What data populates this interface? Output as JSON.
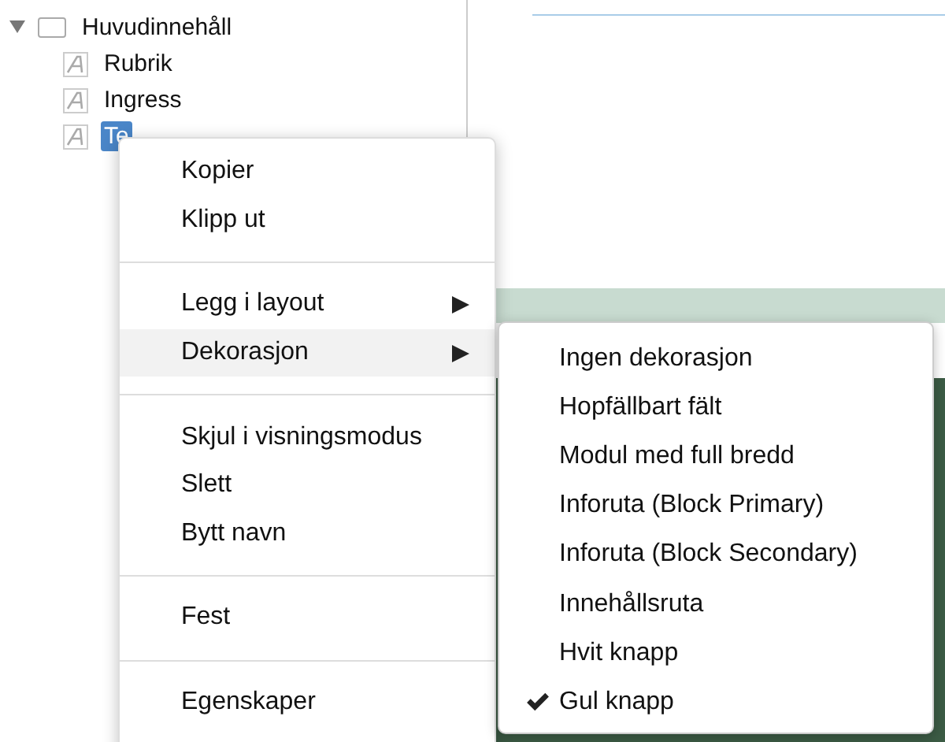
{
  "tree": {
    "items": [
      {
        "label": "Huvudinnehåll",
        "kind": "container",
        "expanded": true,
        "selected": false,
        "children": [
          {
            "label": "Rubrik",
            "kind": "text",
            "selected": false
          },
          {
            "label": "Ingress",
            "kind": "text",
            "selected": false
          },
          {
            "label": "Te",
            "kind": "text",
            "selected": true
          }
        ]
      }
    ]
  },
  "context_menu": {
    "items": [
      {
        "kind": "item",
        "label": "Kopier",
        "has_submenu": false,
        "selected": false
      },
      {
        "kind": "item",
        "label": "Klipp ut",
        "has_submenu": false,
        "selected": false
      },
      {
        "kind": "divider"
      },
      {
        "kind": "item",
        "label": "Legg i layout",
        "has_submenu": true,
        "selected": false
      },
      {
        "kind": "item",
        "label": "Dekorasjon",
        "has_submenu": true,
        "selected": true
      },
      {
        "kind": "divider"
      },
      {
        "kind": "item",
        "label": "Skjul i visningsmodus",
        "has_submenu": false,
        "selected": false
      },
      {
        "kind": "item",
        "label": "Slett",
        "has_submenu": false,
        "selected": false
      },
      {
        "kind": "item",
        "label": "Bytt navn",
        "has_submenu": false,
        "selected": false
      },
      {
        "kind": "divider"
      },
      {
        "kind": "item",
        "label": "Fest",
        "has_submenu": false,
        "selected": false
      },
      {
        "kind": "divider"
      },
      {
        "kind": "item",
        "label": "Egenskaper",
        "has_submenu": false,
        "selected": false
      }
    ]
  },
  "submenu": {
    "items": [
      {
        "label": "Ingen dekorasjon",
        "checked": false
      },
      {
        "label": "Hopfällbart fält",
        "checked": false
      },
      {
        "label": "Modul med full bredd",
        "checked": false
      },
      {
        "label": "Inforuta (Block Primary)",
        "checked": false
      },
      {
        "label": "Inforuta (Block Secondary)",
        "checked": false
      },
      {
        "label": "Innehållsruta",
        "checked": false
      },
      {
        "label": "Hvit knapp",
        "checked": false
      },
      {
        "label": "Gul knapp",
        "checked": true
      }
    ]
  }
}
